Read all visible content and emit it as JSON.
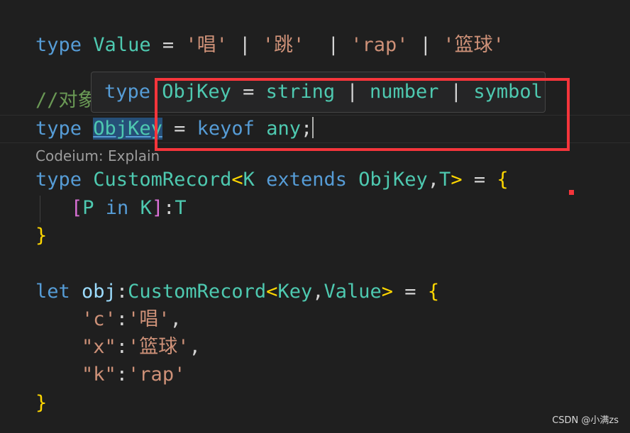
{
  "editor": {
    "line1": {
      "kw": "type",
      "name": "Value",
      "eq": "=",
      "s1": "'唱'",
      "p1": "|",
      "s2": "'跳'",
      "p2": "|",
      "s3": "'rap'",
      "p3": "|",
      "s4": "'篮球'"
    },
    "comment": "//对象",
    "line3": {
      "kw": "type",
      "name": "ObjKey",
      "eq": "=",
      "keyof": "keyof",
      "any": "any",
      "semi": ";"
    },
    "codelens": "Codeium: Explain",
    "line4": {
      "kw": "type",
      "name": "CustomRecord",
      "lt": "<",
      "k": "K",
      "extends": "extends",
      "objkey": "ObjKey",
      "comma": ",",
      "t": "T",
      "gt": ">",
      "eq": "=",
      "brace": "{"
    },
    "line5": {
      "lb": "[",
      "p": "P",
      "in": "in",
      "k": "K",
      "rb": "]",
      "colon": ":",
      "t": "T"
    },
    "line6": {
      "brace": "}"
    },
    "line8": {
      "kw": "let",
      "name": "obj",
      "colon": ":",
      "type": "CustomRecord",
      "lt": "<",
      "key": "Key",
      "comma": ",",
      "value": "Value",
      "gt": ">",
      "eq": "=",
      "brace": "{"
    },
    "line9": {
      "key": "'c'",
      "colon": ":",
      "val": "'唱'",
      "comma": ","
    },
    "line10": {
      "key": "\"x\"",
      "colon": ":",
      "val": "'篮球'",
      "comma": ","
    },
    "line11": {
      "key": "\"k\"",
      "colon": ":",
      "val": "'rap'"
    },
    "line12": {
      "brace": "}"
    }
  },
  "hover": {
    "kw": "type",
    "name": "ObjKey",
    "eq": "=",
    "t1": "string",
    "p1": "|",
    "t2": "number",
    "p2": "|",
    "t3": "symbol"
  },
  "watermark": "CSDN @小满zs"
}
